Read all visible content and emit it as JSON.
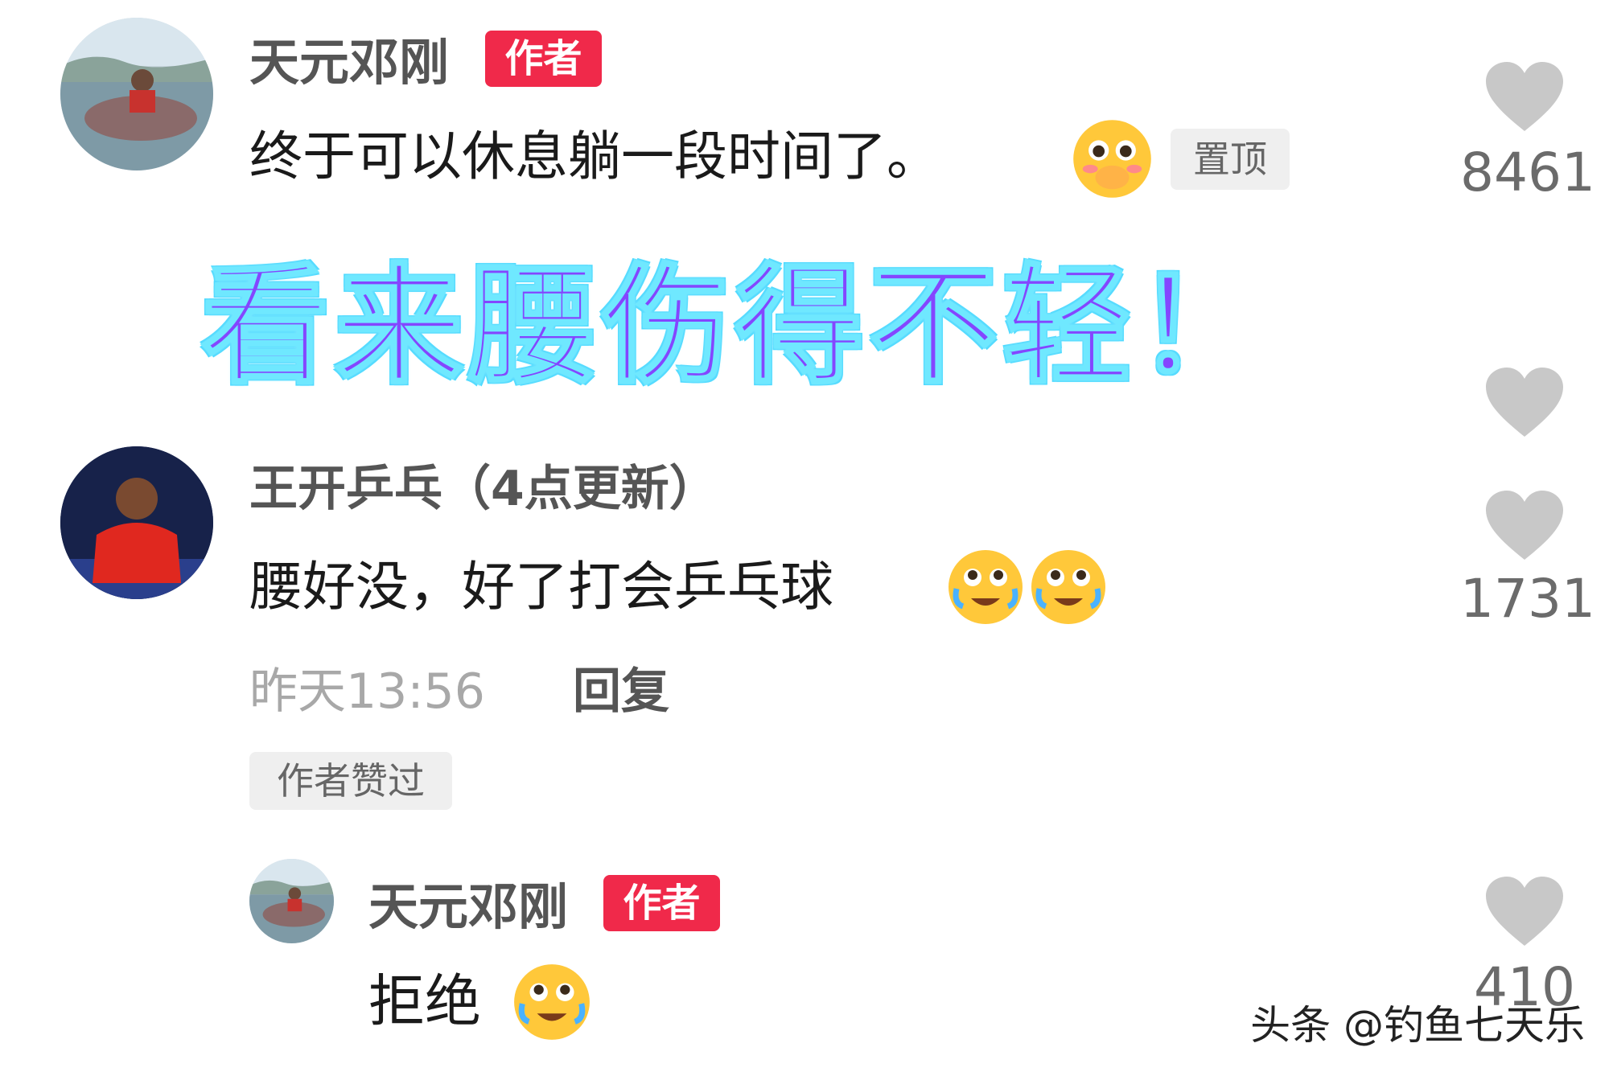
{
  "comments": [
    {
      "username": "天元邓刚",
      "badge": "作者",
      "text": "终于可以休息躺一段时间了。",
      "pinned_label": "置顶",
      "likes": "8461"
    },
    {
      "username": "王开乒乓（4点更新）",
      "text": "腰好没，好了打会乒乓球",
      "timestamp": "昨天13:56",
      "reply_label": "回复",
      "liked_by_author": "作者赞过",
      "likes": "1731"
    },
    {
      "username": "天元邓刚",
      "badge": "作者",
      "text": "拒绝",
      "likes": "410"
    }
  ],
  "overlay_caption": "看来腰伤得不轻！",
  "watermark": "头条 @钓鱼七天乐",
  "colors": {
    "badge": "#f0294a",
    "overlay_fill": "#8446ff",
    "overlay_outline": "#6fe8ff",
    "heart": "#c8c8c8",
    "emoji": "#ffc83a"
  },
  "icons": [
    "heart-icon",
    "blush-emoji-icon",
    "crying-laugh-emoji-icon"
  ]
}
